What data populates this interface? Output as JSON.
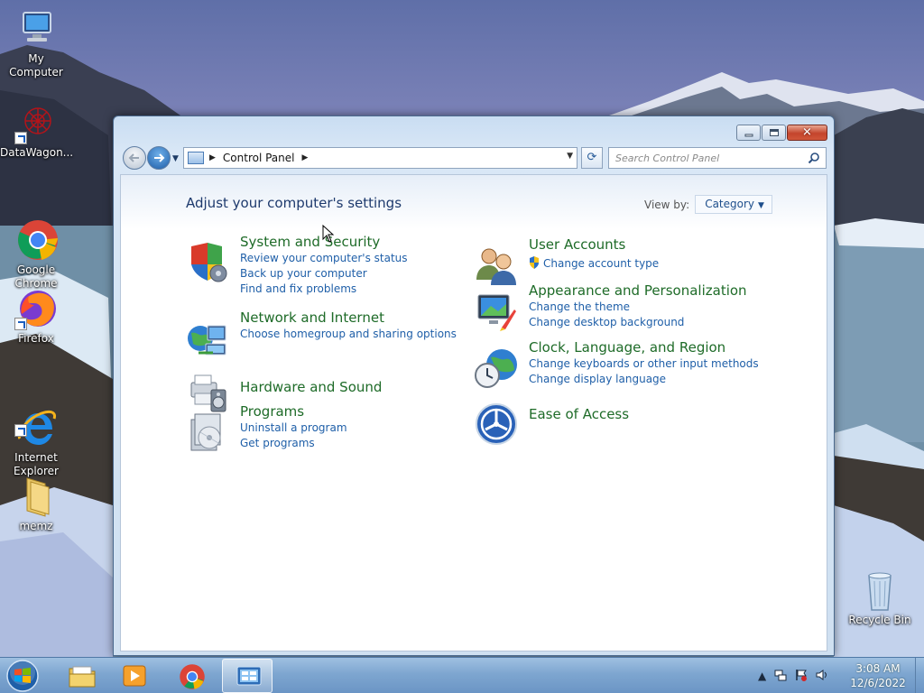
{
  "desktop": {
    "icons": [
      {
        "label": "My Computer"
      },
      {
        "label": "DataWagon..."
      },
      {
        "label": "Google\nChrome"
      },
      {
        "label": "Firefox"
      },
      {
        "label": "Internet\nExplorer"
      },
      {
        "label": "memz"
      },
      {
        "label": "Recycle Bin"
      }
    ]
  },
  "window": {
    "address": {
      "location": "Control Panel"
    },
    "search": {
      "placeholder": "Search Control Panel"
    },
    "page_title": "Adjust your computer's settings",
    "view_by": {
      "label": "View by:",
      "value": "Category"
    },
    "categories": [
      {
        "title": "System and Security",
        "icon": "shield-icon",
        "links": [
          "Review your computer's status",
          "Back up your computer",
          "Find and fix problems"
        ]
      },
      {
        "title": "Network and Internet",
        "icon": "network-globe-icon",
        "links": [
          "Choose homegroup and sharing options"
        ]
      },
      {
        "title": "Hardware and Sound",
        "icon": "printer-speaker-icon",
        "links": []
      },
      {
        "title": "Programs",
        "icon": "programs-box-icon",
        "links": [
          "Uninstall a program",
          "Get programs"
        ]
      },
      {
        "title": "User Accounts",
        "icon": "users-icon",
        "links": [
          "Change account type"
        ]
      },
      {
        "title": "Appearance and Personalization",
        "icon": "monitor-paint-icon",
        "links": [
          "Change the theme",
          "Change desktop background"
        ]
      },
      {
        "title": "Clock, Language, and Region",
        "icon": "clock-globe-icon",
        "links": [
          "Change keyboards or other input methods",
          "Change display language"
        ]
      },
      {
        "title": "Ease of Access",
        "icon": "ease-of-access-icon",
        "links": []
      }
    ]
  },
  "taskbar": {
    "pinned": [
      "start-orb-icon",
      "file-explorer-icon",
      "media-player-icon",
      "chrome-icon",
      "control-panel-icon"
    ],
    "clock": {
      "time": "3:08 AM",
      "date": "12/6/2022"
    }
  },
  "colors": {
    "category_title": "#1e6b28",
    "link": "#1f5fa8",
    "taskbar": "#7ea6d0"
  }
}
